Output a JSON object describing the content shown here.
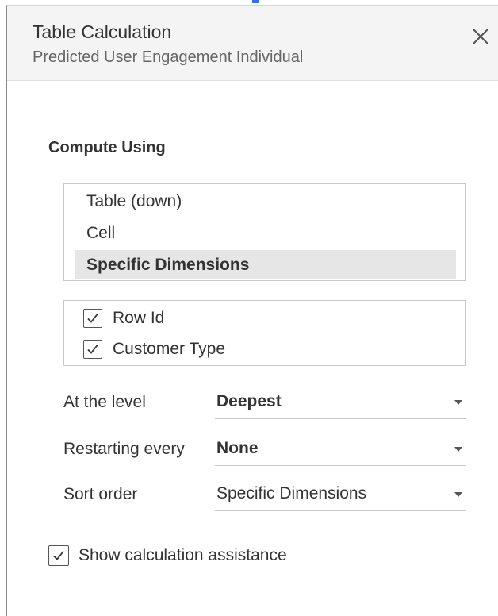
{
  "header": {
    "title": "Table Calculation",
    "subtitle": "Predicted User Engagement Individual"
  },
  "icons": {
    "close": "close-icon",
    "check": "checkmark-icon",
    "caret": "caret-down-icon"
  },
  "compute": {
    "title": "Compute Using",
    "options": [
      {
        "label": "Table (down)",
        "selected": false
      },
      {
        "label": "Cell",
        "selected": false
      },
      {
        "label": "Specific Dimensions",
        "selected": true
      }
    ]
  },
  "dimensions": [
    {
      "label": "Row Id",
      "checked": true
    },
    {
      "label": "Customer Type",
      "checked": true
    }
  ],
  "settings": {
    "level": {
      "label": "At the level",
      "value": "Deepest"
    },
    "restart": {
      "label": "Restarting every",
      "value": "None"
    },
    "sort": {
      "label": "Sort order",
      "value": "Specific Dimensions"
    }
  },
  "assistance": {
    "label": "Show calculation assistance",
    "checked": true
  },
  "colors": {
    "header_bg": "#f4f4f4",
    "selected_bg": "#e6e6e6",
    "border": "#c8c8c8",
    "text": "#333333",
    "subtext": "#666666",
    "accent": "#3a6fd8"
  }
}
